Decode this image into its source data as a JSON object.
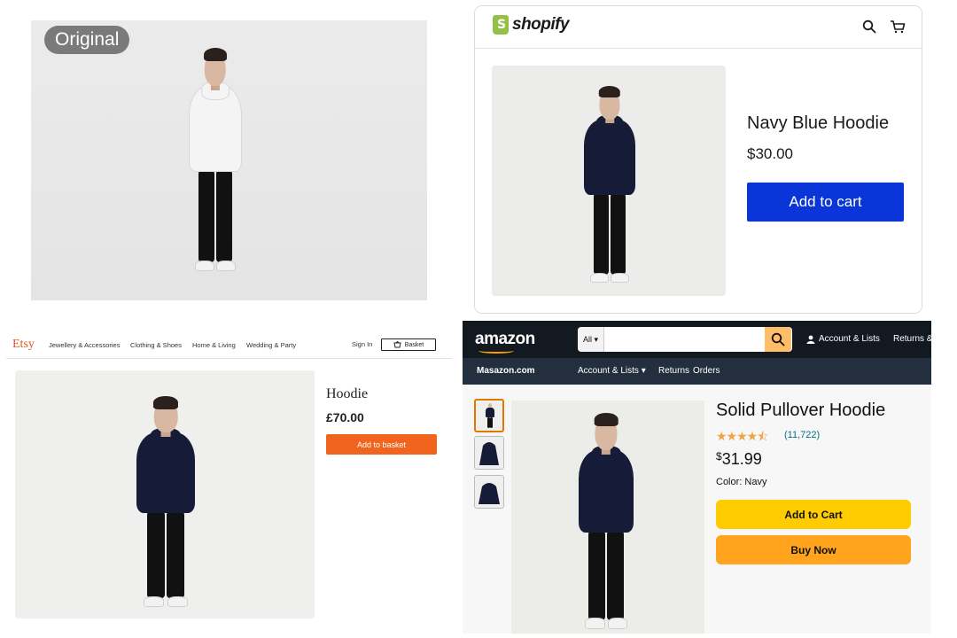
{
  "original": {
    "badge": "Original"
  },
  "shopify": {
    "brand": "shopify",
    "product_title": "Navy Blue Hoodie",
    "price": "$30.00",
    "add_to_cart": "Add to cart",
    "icons": [
      "search-icon",
      "cart-icon"
    ],
    "accent_color": "#0a35d9",
    "logo_color": "#95bf47"
  },
  "etsy": {
    "brand": "Etsy",
    "nav": [
      "Jewellery & Accessories",
      "Clothing & Shoes",
      "Home & Living",
      "Wedding & Party"
    ],
    "sign_in": "Sign In",
    "basket": "Basket",
    "product_title": "Hoodie",
    "price": "£70.00",
    "add_to_basket": "Add to basket",
    "accent_color": "#f1641e"
  },
  "amazon": {
    "brand": "amazon",
    "search_category": "All",
    "account": "Account & Lists",
    "returns_top": "Returns &",
    "site": "Masazon.com",
    "subnav": [
      "Account & Lists",
      "Returns",
      "Orders"
    ],
    "product_title": "Solid Pullover Hoodie",
    "rating": 4.5,
    "reviews": "(11,722)",
    "price_symbol": "$",
    "price": "31.99",
    "color_label": "Color: Navy",
    "add_to_cart": "Add to Cart",
    "buy_now": "Buy Now",
    "button_colors": {
      "add_to_cart": "#ffcc00",
      "buy_now": "#ffa41c"
    },
    "header_color": "#131921"
  }
}
